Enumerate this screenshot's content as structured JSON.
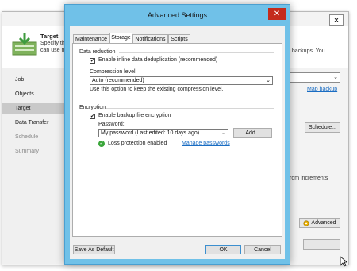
{
  "background": {
    "header": {
      "title": "Target",
      "line1": "Specify the",
      "line2": "can use m",
      "right_text": "full backups. You"
    },
    "sidebar": {
      "items": [
        {
          "label": "Job",
          "state": "normal"
        },
        {
          "label": "Objects",
          "state": "normal"
        },
        {
          "label": "Target",
          "state": "active"
        },
        {
          "label": "Data Transfer",
          "state": "normal"
        },
        {
          "label": "Schedule",
          "state": "dim"
        },
        {
          "label": "Summary",
          "state": "dim"
        }
      ]
    },
    "map_backup_link": "Map backup",
    "schedule_button": "Schedule...",
    "increments_text": "rom increments",
    "advanced_button": "Advanced",
    "close_glyph": "x"
  },
  "dialog": {
    "title": "Advanced Settings",
    "close_glyph": "✕",
    "tabs": [
      {
        "label": "Maintenance",
        "active": false
      },
      {
        "label": "Storage",
        "active": true
      },
      {
        "label": "Notifications",
        "active": false
      },
      {
        "label": "Scripts",
        "active": false
      }
    ],
    "data_reduction": {
      "heading": "Data reduction",
      "dedup_label": "Enable inline data deduplication (recommended)",
      "dedup_checked": true,
      "compression_label": "Compression level:",
      "compression_value": "Auto (recommended)",
      "compression_hint": "Use this option to keep the existing compression level."
    },
    "encryption": {
      "heading": "Encryption",
      "enable_label": "Enable backup file encryption",
      "enable_checked": true,
      "password_label": "Password:",
      "password_value": "My password (Last edited: 10 days ago)",
      "add_button": "Add...",
      "loss_protection_text": "Loss protection enabled",
      "manage_link": "Manage passwords"
    },
    "buttons": {
      "save_default": "Save As Default",
      "ok": "OK",
      "cancel": "Cancel"
    }
  },
  "icons": {
    "check_glyph": "✔",
    "chevron_glyph": "⌄",
    "ok_glyph": "✓"
  },
  "colors": {
    "dialog_frame": "#70c1e8",
    "close_button": "#c42b1c",
    "link": "#1a6dc3",
    "success": "#3aa63a"
  }
}
